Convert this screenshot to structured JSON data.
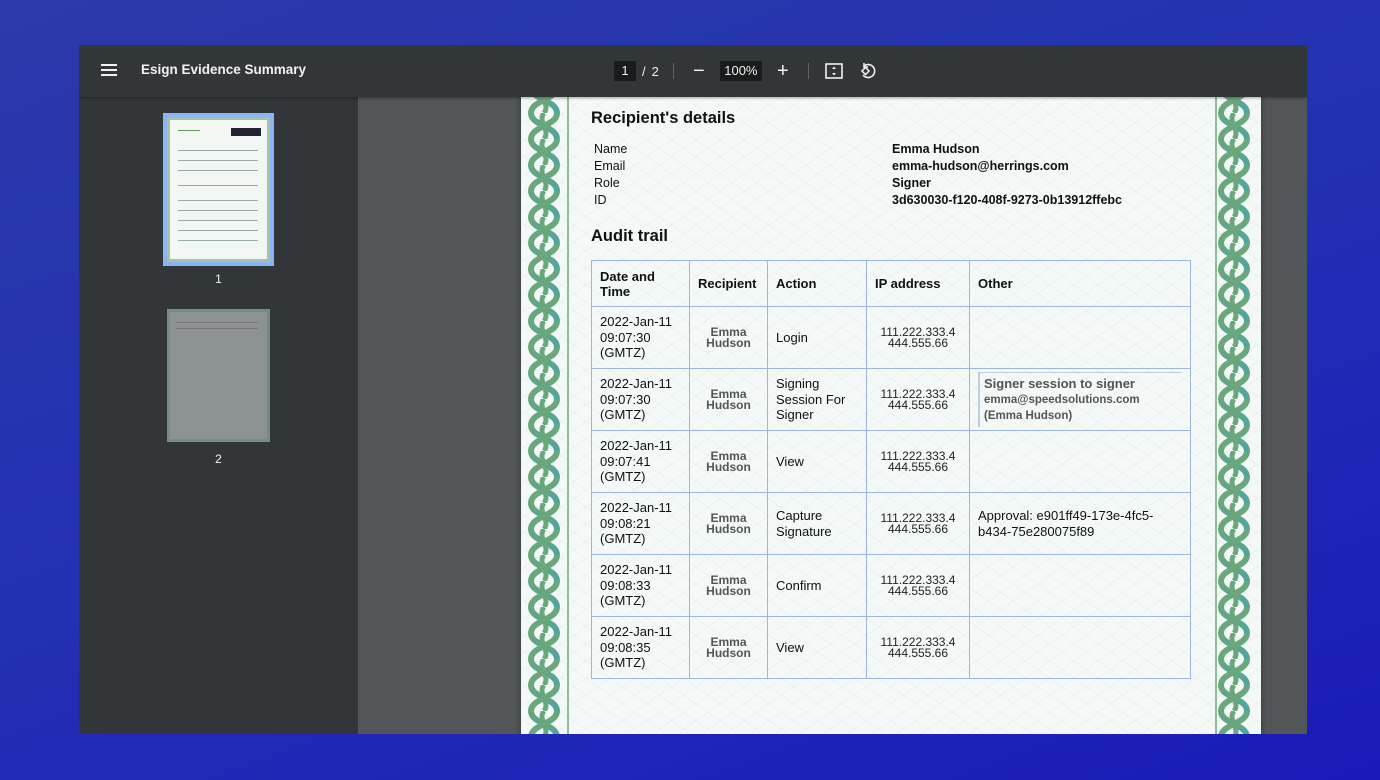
{
  "toolbar": {
    "title": "Esign Evidence Summary",
    "current_page": "1",
    "page_separator": "/",
    "total_pages": "2",
    "zoom_level": "100%",
    "zoom_out_label": "−",
    "zoom_in_label": "+"
  },
  "sidebar": {
    "thumbnails": [
      {
        "label": "1",
        "active": true
      },
      {
        "label": "2",
        "active": false
      }
    ]
  },
  "document": {
    "recipient_heading": "Recipient's details",
    "recipient": {
      "name_label": "Name",
      "name_value": "Emma Hudson",
      "email_label": "Email",
      "email_value": "emma-hudson@herrings.com",
      "role_label": "Role",
      "role_value": "Signer",
      "id_label": "ID",
      "id_value": "3d630030-f120-408f-9273-0b13912ffebc"
    },
    "audit_heading": "Audit trail",
    "audit_table": {
      "headers": [
        "Date and Time",
        "Recipient",
        "Action",
        "IP address",
        "Other"
      ],
      "rows": [
        {
          "date": "2022-Jan-11",
          "time": "09:07:30",
          "tz": "(GMTZ)",
          "recipient_first": "Emma",
          "recipient_last": "Hudson",
          "action": "Login",
          "ip1": "111.222.333.4",
          "ip2": "444.555.66",
          "other": ""
        },
        {
          "date": "2022-Jan-11",
          "time": "09:07:30",
          "tz": "(GMTZ)",
          "recipient_first": "Emma",
          "recipient_last": "Hudson",
          "action": "Signing Session For Signer",
          "ip1": "111.222.333.4",
          "ip2": "444.555.66",
          "other_l1": "Signer session  to signer",
          "other_l2": "emma@speedsolutions.com",
          "other_l3": "(Emma Hudson)"
        },
        {
          "date": "2022-Jan-11",
          "time": "09:07:41",
          "tz": "(GMTZ)",
          "recipient_first": "Emma",
          "recipient_last": "Hudson",
          "action": "View",
          "ip1": "111.222.333.4",
          "ip2": "444.555.66",
          "other": ""
        },
        {
          "date": "2022-Jan-11",
          "time": "09:08:21",
          "tz": "(GMTZ)",
          "recipient_first": "Emma",
          "recipient_last": "Hudson",
          "action": "Capture Signature",
          "ip1": "111.222.333.4",
          "ip2": "444.555.66",
          "other": "Approval: e901ff49-173e-4fc5-b434-75e280075f89"
        },
        {
          "date": "2022-Jan-11",
          "time": "09:08:33",
          "tz": "(GMTZ)",
          "recipient_first": "Emma",
          "recipient_last": "Hudson",
          "action": "Confirm",
          "ip1": "111.222.333.4",
          "ip2": "444.555.66",
          "other": ""
        },
        {
          "date": "2022-Jan-11",
          "time": "09:08:35",
          "tz": "(GMTZ)",
          "recipient_first": "Emma",
          "recipient_last": "Hudson",
          "action": "View",
          "ip1": "111.222.333.4",
          "ip2": "444.555.66",
          "other": ""
        }
      ]
    }
  }
}
